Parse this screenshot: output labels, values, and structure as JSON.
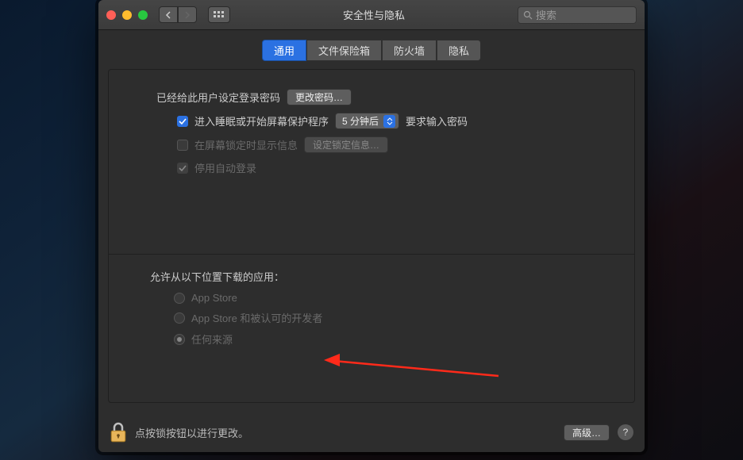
{
  "window": {
    "title": "安全性与隐私",
    "search_placeholder": "搜索"
  },
  "tabs": [
    {
      "label": "通用",
      "active": true
    },
    {
      "label": "文件保险箱",
      "active": false
    },
    {
      "label": "防火墙",
      "active": false
    },
    {
      "label": "隐私",
      "active": false
    }
  ],
  "upper": {
    "password_label": "已经给此用户设定登录密码",
    "change_password_btn": "更改密码…",
    "require_pw_pre": "进入睡眠或开始屏幕保护程序",
    "require_pw_select": "5 分钟后",
    "require_pw_post": "要求输入密码",
    "show_message_label": "在屏幕锁定时显示信息",
    "set_lock_msg_btn": "设定锁定信息…",
    "disable_autologin_label": "停用自动登录"
  },
  "lower": {
    "heading": "允许从以下位置下载的应用：",
    "options": [
      {
        "label": "App Store",
        "selected": false
      },
      {
        "label": "App Store 和被认可的开发者",
        "selected": false
      },
      {
        "label": "任何来源",
        "selected": true
      }
    ]
  },
  "footer": {
    "lock_text": "点按锁按钮以进行更改。",
    "advanced_btn": "高级…",
    "help": "?"
  }
}
